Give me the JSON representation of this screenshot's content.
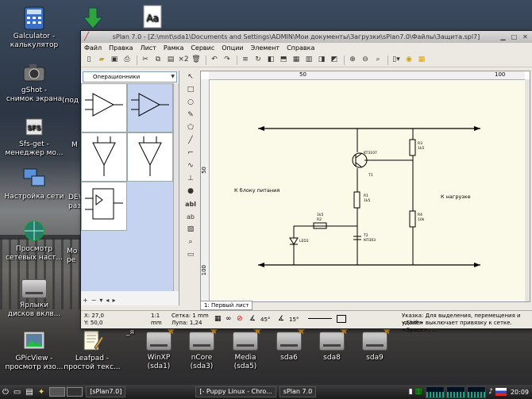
{
  "desktop": {
    "left_icons": [
      {
        "name": "calculator",
        "label": "Galculator -\nкалькулятор"
      },
      {
        "name": "gshot",
        "label": "gShot -\nснимок экрана"
      },
      {
        "name": "sfs-get",
        "label": "Sfs-get -\nменеджер мо..."
      },
      {
        "name": "network-settings",
        "label": "Настройка сети"
      },
      {
        "name": "network-browse",
        "label": "Просмотр\nсетевых наст..."
      },
      {
        "name": "drives-shortcuts",
        "label": "Ярлыки\nдисков вклв..."
      },
      {
        "name": "gpicview",
        "label": "GPicView -\nпросмотр изо..."
      }
    ],
    "partial_labels": [
      "(под",
      "М",
      "DEV\nразд",
      "Мо\nре"
    ],
    "leafpad": {
      "label": "Leafpad -\nпростой текс..."
    },
    "drives": [
      {
        "label": "WinXP\n(sda1)"
      },
      {
        "label": "nCore\n(sda3)"
      },
      {
        "label": "Media\n(sda5)"
      },
      {
        "label": "sda6"
      },
      {
        "label": "sda8"
      },
      {
        "label": "sda9"
      }
    ]
  },
  "window": {
    "title": "sPlan 7.0 - [Z:\\mnt\\sda1\\Documents and Settings\\ADMIN\\Мои документы\\Загрузки\\sPlan7.0\\Файлы\\Защита.spl7]",
    "menu": [
      "Файл",
      "Правка",
      "Лист",
      "Рамка",
      "Сервис",
      "Опции",
      "Элемент",
      "Справка"
    ],
    "library_selected": "Операционники",
    "ruler_top_marks": [
      "50",
      "100"
    ],
    "ruler_left_marks": [
      "50",
      "100"
    ],
    "sheet_tab": "1: Первый лист",
    "schematic": {
      "label_power": "К блоку питания",
      "label_load": "К нагрузке",
      "parts": [
        "KT3107",
        "T1",
        "R3",
        "1k5",
        "R1",
        "1k5",
        "R4",
        "10k",
        "R2",
        "1k5",
        "LED1",
        "T2",
        "КП303"
      ]
    },
    "status": {
      "x": "X: 27,0",
      "y": "Y: 50,0",
      "unit1": "1:1",
      "unit2": "mm",
      "grid": "Сетка: 1 mm",
      "zoom": "Лупа: 1,24",
      "angle1": "45°",
      "angle2": "15°",
      "hint1": "Указка: Для выделения, перемещения и удален",
      "hint2": "<Shift> выключает привязку к сетке. <Space>, ..."
    }
  },
  "taskbar": {
    "tasks": [
      "[sPlan7.0]",
      "[- Puppy Linux - Chro...",
      "sPlan 7.0"
    ],
    "clock": "20:09"
  }
}
